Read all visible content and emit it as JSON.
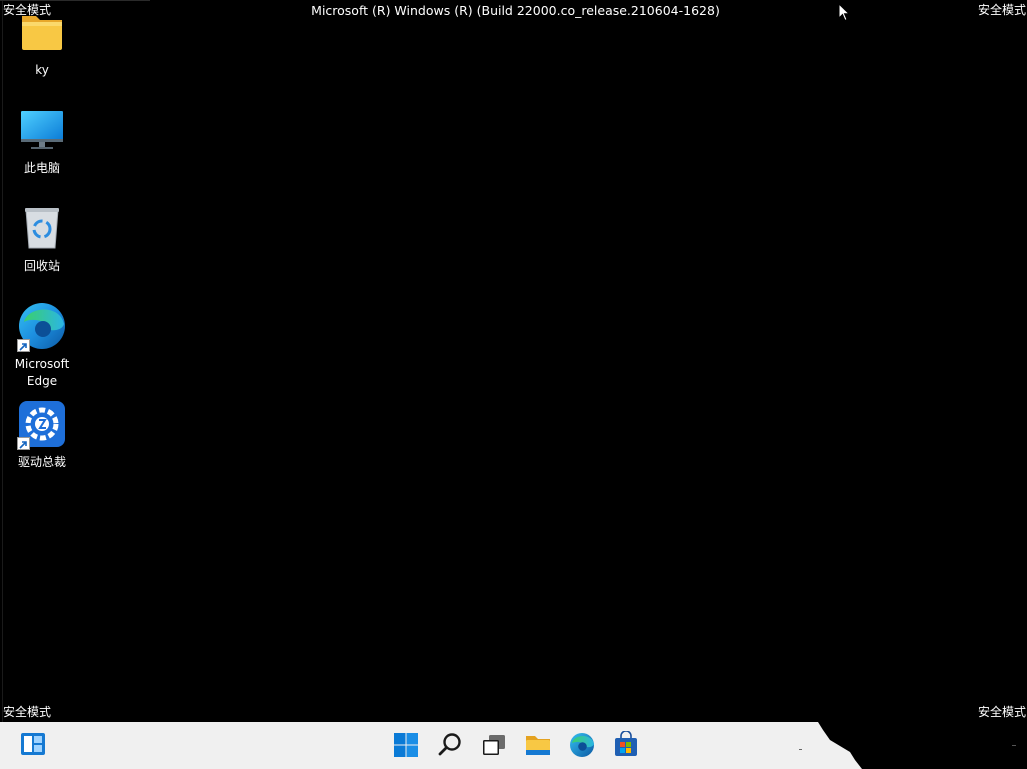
{
  "overlay": {
    "safe_mode_top_left": "安全模式",
    "safe_mode_top_right": "安全模式",
    "safe_mode_bottom_left": "安全模式",
    "safe_mode_bottom_right": "安全模式",
    "build_title": "Microsoft (R) Windows (R) (Build 22000.co_release.210604-1628)"
  },
  "desktop": {
    "icons": [
      {
        "label": "ky",
        "icon": "folder-icon"
      },
      {
        "label": "此电脑",
        "icon": "monitor-icon"
      },
      {
        "label": "回收站",
        "icon": "recycle-bin-icon"
      },
      {
        "label": "Microsoft\nEdge",
        "label_line1": "Microsoft",
        "label_line2": "Edge",
        "icon": "edge-icon"
      },
      {
        "label": "驱动总裁",
        "icon": "driver-tool-icon"
      }
    ]
  },
  "taskbar": {
    "items": [
      {
        "name": "widgets",
        "icon": "widgets-icon"
      },
      {
        "name": "start",
        "icon": "windows-logo-icon"
      },
      {
        "name": "search",
        "icon": "search-icon"
      },
      {
        "name": "task-view",
        "icon": "task-view-icon"
      },
      {
        "name": "file-explorer",
        "icon": "folder-icon"
      },
      {
        "name": "edge",
        "icon": "edge-icon"
      },
      {
        "name": "store",
        "icon": "store-icon"
      }
    ]
  },
  "colors": {
    "desktop_bg": "#000000",
    "taskbar_bg": "#f0f0f0",
    "windows_blue": "#0a7ad6",
    "folder_yellow": "#f8c844"
  }
}
